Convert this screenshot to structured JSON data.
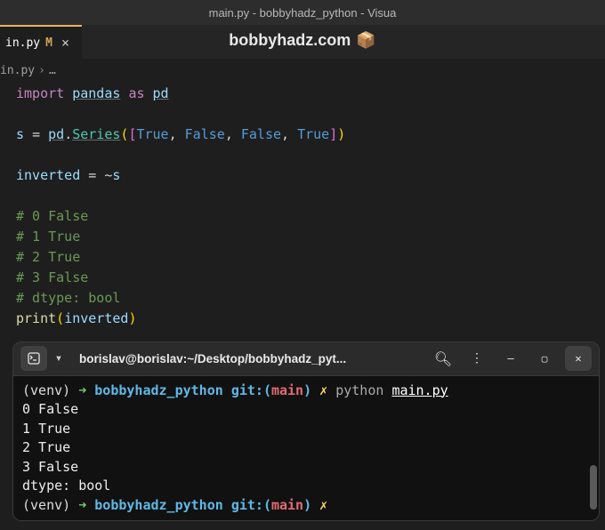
{
  "window": {
    "title": "main.py - bobbyhadz_python - Visua"
  },
  "watermark": {
    "text": "bobbyhadz.com",
    "icon": "📦"
  },
  "tab": {
    "filename": "in.py",
    "modified_marker": "M",
    "close": "×"
  },
  "breadcrumb": {
    "file": "in.py",
    "sep": "›",
    "more": "…"
  },
  "code": {
    "l1": {
      "import": "import",
      "module": "pandas",
      "as": "as",
      "alias": "pd"
    },
    "l2": {
      "var": "s",
      "eq": "=",
      "obj": "pd",
      "dot": ".",
      "cls": "Series",
      "open1": "(",
      "open2": "[",
      "t": "True",
      "f": "False",
      "comma": ",",
      "close2": "]",
      "close1": ")"
    },
    "l3": {
      "var": "inverted",
      "eq": "=",
      "tilde": "~",
      "src": "s"
    },
    "c1": "# 0    False",
    "c2": "# 1     True",
    "c3": "# 2     True",
    "c4": "# 3    False",
    "c5": "# dtype: bool",
    "l4": {
      "fn": "print",
      "open": "(",
      "arg": "inverted",
      "close": ")"
    }
  },
  "terminal": {
    "header": {
      "title": "borislav@borislav:~/Desktop/bobbyhadz_pyt...",
      "newTabIcon": "⊞",
      "dropdown": "▾",
      "search": "⌕",
      "menu": "⋮",
      "min": "—",
      "max": "▢",
      "close": "✕"
    },
    "prompt1": {
      "venv": "(venv)",
      "arrow": "➜",
      "dir": "bobbyhadz_python",
      "git": "git:",
      "po": "(",
      "branch": "main",
      "pc": ")",
      "ex": "✗",
      "cmd": "python",
      "file": "main.py"
    },
    "output": [
      "0    False",
      "1     True",
      "2     True",
      "3    False",
      "dtype: bool"
    ],
    "prompt2": {
      "venv": "(venv)",
      "arrow": "➜",
      "dir": "bobbyhadz_python",
      "git": "git:",
      "po": "(",
      "branch": "main",
      "pc": ")",
      "ex": "✗"
    }
  }
}
